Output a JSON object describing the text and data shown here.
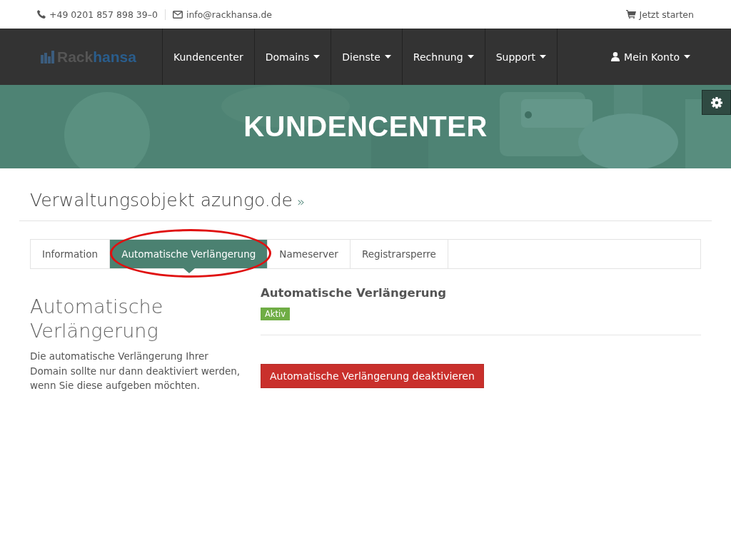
{
  "top_bar": {
    "phone": "+49 0201 857 898 39–0",
    "email": "info@rackhansa.de",
    "cart_link": "Jetzt starten"
  },
  "nav": {
    "logo": {
      "part_1": "Rack",
      "part_2": "hansa"
    },
    "items": [
      {
        "label": "Kundencenter",
        "dropdown": false
      },
      {
        "label": "Domains",
        "dropdown": true
      },
      {
        "label": "Dienste",
        "dropdown": true
      },
      {
        "label": "Rechnung",
        "dropdown": true
      },
      {
        "label": "Support",
        "dropdown": true
      }
    ],
    "account": {
      "label": "Mein Konto",
      "dropdown": true
    }
  },
  "hero": {
    "title": "KUNDENCENTER"
  },
  "page": {
    "heading": "Verwaltungsobjekt azungo.de",
    "heading_mark": "»",
    "tabs": [
      {
        "label": "Information",
        "selected": false,
        "highlighted": false
      },
      {
        "label": "Automatische Verlängerung",
        "selected": true,
        "highlighted": true
      },
      {
        "label": "Nameserver",
        "selected": false,
        "highlighted": false
      },
      {
        "label": "Registrarsperre",
        "selected": false,
        "highlighted": false
      }
    ],
    "sidebar": {
      "title": "Automatische Verlängerung",
      "text": "Die automatische Verlängerung Ihrer Domain sollte nur dann deaktiviert werden, wenn Sie diese aufgeben möchten."
    },
    "panel": {
      "title": "Automatische Verlängerung",
      "status": {
        "label": "Aktiv",
        "color": "#6fad45"
      },
      "button": "Automatische Verlängerung deaktivieren"
    }
  }
}
